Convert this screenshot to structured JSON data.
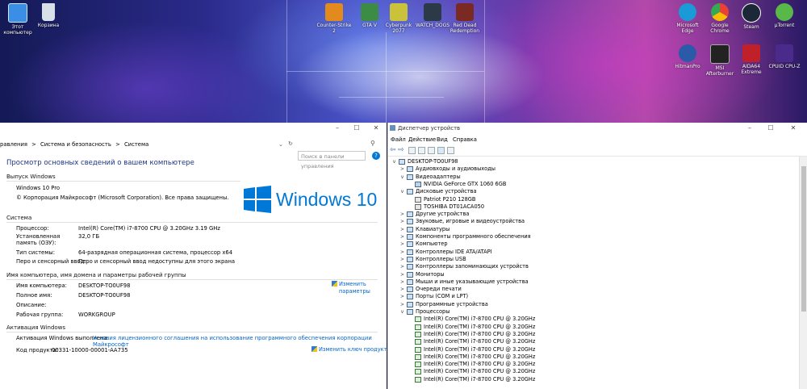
{
  "desktop": {
    "left_icons": [
      {
        "label": "Этот компьютер",
        "icon": "this-pc-icon",
        "color": "#3a8ee6"
      },
      {
        "label": "Корзина",
        "icon": "recycle-bin-icon",
        "color": "#d7dfe8"
      }
    ],
    "center_icons": [
      {
        "label": "Counter-Strike 2",
        "icon": "cs2-icon",
        "color": "#e38a1e"
      },
      {
        "label": "GTA V",
        "icon": "gta-icon",
        "color": "#3c8c46"
      },
      {
        "label": "Cyberpunk 2077",
        "icon": "cyberpunk-icon",
        "color": "#c9c23a"
      },
      {
        "label": "WATCH_DOGS",
        "icon": "watchdogs-icon",
        "color": "#2c3a48"
      },
      {
        "label": "Red Dead Redemption",
        "icon": "rdr-icon",
        "color": "#7a2a22"
      }
    ],
    "right_icons": [
      {
        "label": "Microsoft Edge",
        "icon": "edge-icon",
        "color": "#1a9ad6"
      },
      {
        "label": "Google Chrome",
        "icon": "chrome-icon",
        "color": "#e94235"
      },
      {
        "label": "Steam",
        "icon": "steam-icon",
        "color": "#1b2838"
      },
      {
        "label": "µTorrent",
        "icon": "utorrent-icon",
        "color": "#58b848"
      },
      {
        "label": "HitmanPro",
        "icon": "hitmanpro-icon",
        "color": "#2a5aa8"
      },
      {
        "label": "MSI Afterburner",
        "icon": "afterburner-icon",
        "color": "#222"
      },
      {
        "label": "AIDA64 Extreme",
        "icon": "aida64-icon",
        "color": "#c0202a"
      },
      {
        "label": "CPUID CPU-Z",
        "icon": "cpuz-icon",
        "color": "#4a2a8a"
      }
    ]
  },
  "system": {
    "breadcrumb": [
      "равления",
      ">",
      "Система и безопасность",
      ">",
      "Система"
    ],
    "search_placeholder": "Поиск в панели управления",
    "title": "Просмотр основных сведений о вашем компьютере",
    "edition_header": "Выпуск Windows",
    "edition": "Windows 10 Pro",
    "copyright": "© Корпорация Майкрософт (Microsoft Corporation). Все права защищены.",
    "logo_text": "Windows 10",
    "system_header": "Система",
    "specs": [
      {
        "label": "Процессор:",
        "value": "Intel(R) Core(TM) i7-8700 CPU @ 3.20GHz   3.19 GHz"
      },
      {
        "label": "Установленная память (ОЗУ):",
        "value": "32,0 ГБ"
      },
      {
        "label": "Тип системы:",
        "value": "64-разрядная операционная система, процессор x64"
      },
      {
        "label": "Перо и сенсорный ввод:",
        "value": "Перо и сенсорный ввод недоступны для этого экрана"
      }
    ],
    "name_header": "Имя компьютера, имя домена и параметры рабочей группы",
    "names": [
      {
        "label": "Имя компьютера:",
        "value": "DESKTOP-TO0UF98"
      },
      {
        "label": "Полное имя:",
        "value": "DESKTOP-TO0UF98"
      },
      {
        "label": "Описание:",
        "value": ""
      },
      {
        "label": "Рабочая группа:",
        "value": "WORKGROUP"
      }
    ],
    "change_params": "Изменить параметры",
    "activation_header": "Активация Windows",
    "activation_text": "Активация Windows выполнена",
    "license_link": "Условия лицензионного соглашения на использование программного обеспечения корпорации Майкрософт",
    "product_key_label": "Код продукта:",
    "product_key": "00331-10000-00001-AA735",
    "change_key": "Изменить ключ продукта"
  },
  "devmgr": {
    "title": "Диспетчер устройств",
    "menu": [
      "Файл",
      "Действие",
      "Вид",
      "Справка"
    ],
    "root": "DESKTOP-TO0UF98",
    "tree": [
      {
        "label": "Аудиовходы и аудиовыходы",
        "exp": ">",
        "depth": 1
      },
      {
        "label": "Видеоадаптеры",
        "exp": "v",
        "depth": 1
      },
      {
        "label": "NVIDIA GeForce GTX 1060 6GB",
        "exp": "",
        "depth": 2,
        "kind": "gpu"
      },
      {
        "label": "Дисковые устройства",
        "exp": "v",
        "depth": 1
      },
      {
        "label": "Patriot P210 128GB",
        "exp": "",
        "depth": 2,
        "kind": "disk"
      },
      {
        "label": "TOSHIBA DT01ACA050",
        "exp": "",
        "depth": 2,
        "kind": "disk"
      },
      {
        "label": "Другие устройства",
        "exp": ">",
        "depth": 1
      },
      {
        "label": "Звуковые, игровые и видеоустройства",
        "exp": ">",
        "depth": 1
      },
      {
        "label": "Клавиатуры",
        "exp": ">",
        "depth": 1
      },
      {
        "label": "Компоненты программного обеспечения",
        "exp": ">",
        "depth": 1
      },
      {
        "label": "Компьютер",
        "exp": ">",
        "depth": 1
      },
      {
        "label": "Контроллеры IDE ATA/ATAPI",
        "exp": ">",
        "depth": 1
      },
      {
        "label": "Контроллеры USB",
        "exp": ">",
        "depth": 1
      },
      {
        "label": "Контроллеры запоминающих устройств",
        "exp": ">",
        "depth": 1
      },
      {
        "label": "Мониторы",
        "exp": ">",
        "depth": 1
      },
      {
        "label": "Мыши и иные указывающие устройства",
        "exp": ">",
        "depth": 1
      },
      {
        "label": "Очереди печати",
        "exp": ">",
        "depth": 1
      },
      {
        "label": "Порты (COM и LPT)",
        "exp": ">",
        "depth": 1
      },
      {
        "label": "Программные устройства",
        "exp": ">",
        "depth": 1
      },
      {
        "label": "Процессоры",
        "exp": "v",
        "depth": 1
      },
      {
        "label": "Intel(R) Core(TM) i7-8700 CPU @ 3.20GHz",
        "exp": "",
        "depth": 2,
        "kind": "cpu"
      },
      {
        "label": "Intel(R) Core(TM) i7-8700 CPU @ 3.20GHz",
        "exp": "",
        "depth": 2,
        "kind": "cpu"
      },
      {
        "label": "Intel(R) Core(TM) i7-8700 CPU @ 3.20GHz",
        "exp": "",
        "depth": 2,
        "kind": "cpu"
      },
      {
        "label": "Intel(R) Core(TM) i7-8700 CPU @ 3.20GHz",
        "exp": "",
        "depth": 2,
        "kind": "cpu"
      },
      {
        "label": "Intel(R) Core(TM) i7-8700 CPU @ 3.20GHz",
        "exp": "",
        "depth": 2,
        "kind": "cpu"
      },
      {
        "label": "Intel(R) Core(TM) i7-8700 CPU @ 3.20GHz",
        "exp": "",
        "depth": 2,
        "kind": "cpu"
      },
      {
        "label": "Intel(R) Core(TM) i7-8700 CPU @ 3.20GHz",
        "exp": "",
        "depth": 2,
        "kind": "cpu"
      },
      {
        "label": "Intel(R) Core(TM) i7-8700 CPU @ 3.20GHz",
        "exp": "",
        "depth": 2,
        "kind": "cpu"
      },
      {
        "label": "Intel(R) Core(TM) i7-8700 CPU @ 3.20GHz",
        "exp": "",
        "depth": 2,
        "kind": "cpu"
      }
    ]
  },
  "colors": {
    "accent": "#0078d7",
    "link": "#0066cc",
    "title": "#1e3287"
  }
}
